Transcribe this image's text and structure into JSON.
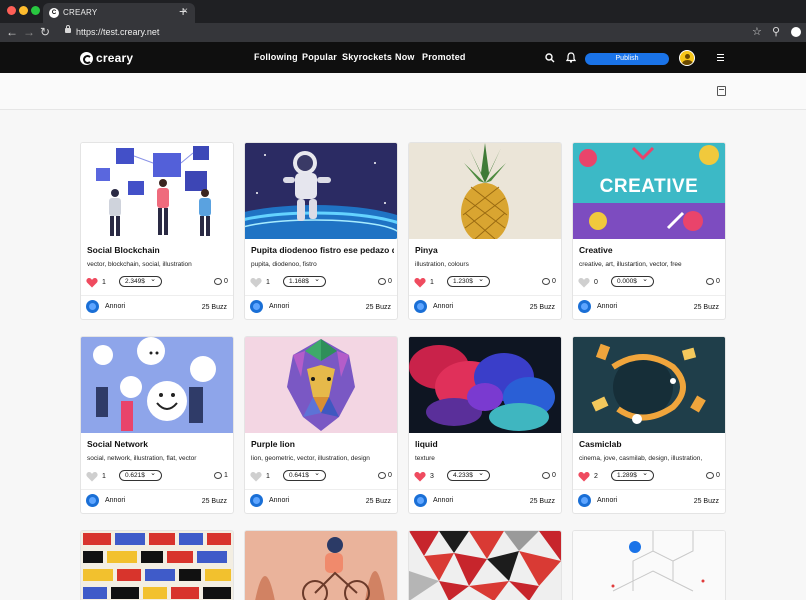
{
  "browser": {
    "tab_title": "CREARY",
    "tab_favicon": "C",
    "url": "https://test.creary.net"
  },
  "header": {
    "logo_text": "creary",
    "nav": [
      "Following",
      "Popular",
      "Skyrockets",
      "Now",
      "Promoted"
    ],
    "publish_label": "Publish"
  },
  "icons": {
    "back": "back-arrow-icon",
    "forward": "forward-arrow-icon",
    "reload": "reload-icon",
    "search": "search-icon",
    "bell": "bell-icon",
    "menu": "hamburger-menu-icon",
    "layout": "layout-toggle-icon"
  },
  "colors": {
    "brand_blue": "#1a73e8",
    "heart_liked": "#ef4b5f",
    "heart_unliked": "#cfcfcf",
    "header_bg": "#0f0f0f"
  },
  "posts": [
    {
      "title": "Social Blockchain",
      "tags": "vector, blockchain, social, illustration",
      "liked": true,
      "votes": "1",
      "payout": "2.349$",
      "comments": "0",
      "author": "Annori",
      "buzz": "25 Buzz"
    },
    {
      "title": "Pupita diodenoo fistro ese pedazo de ...",
      "tags": "pupita, diodenoo, fistro",
      "liked": false,
      "votes": "1",
      "payout": "1.168$",
      "comments": "0",
      "author": "Annori",
      "buzz": "25 Buzz"
    },
    {
      "title": "Pinya",
      "tags": "illustration, colours",
      "liked": true,
      "votes": "1",
      "payout": "1.230$",
      "comments": "0",
      "author": "Annori",
      "buzz": "25 Buzz"
    },
    {
      "title": "Creative",
      "tags": "creative, art, illustartion, vector, free",
      "liked": false,
      "votes": "0",
      "payout": "0.000$",
      "comments": "0",
      "author": "Annori",
      "buzz": "25 Buzz"
    },
    {
      "title": "Social Network",
      "tags": "social, network, illustration, flat, vector",
      "liked": false,
      "votes": "1",
      "payout": "0.621$",
      "comments": "1",
      "author": "Annori",
      "buzz": "25 Buzz"
    },
    {
      "title": "Purple lion",
      "tags": "lion, geometric, vector, illustration, design",
      "liked": false,
      "votes": "1",
      "payout": "0.641$",
      "comments": "0",
      "author": "Annori",
      "buzz": "25 Buzz"
    },
    {
      "title": "liquid",
      "tags": "texture",
      "liked": true,
      "votes": "3",
      "payout": "4.233$",
      "comments": "0",
      "author": "Annori",
      "buzz": "25 Buzz"
    },
    {
      "title": "Casmiclab",
      "tags": "cinema, jove, casmilab, design, illustration,",
      "liked": true,
      "votes": "2",
      "payout": "1.289$",
      "comments": "0",
      "author": "Annori",
      "buzz": "25 Buzz"
    }
  ]
}
